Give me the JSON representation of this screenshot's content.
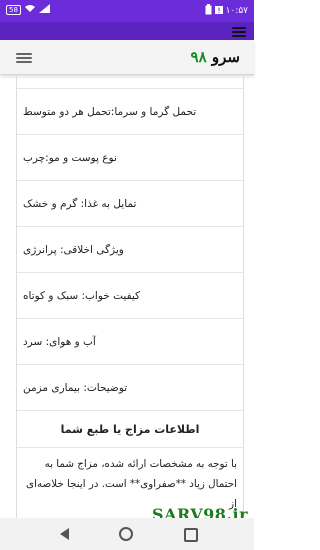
{
  "status_bar": {
    "time": "۱۰:۵۷",
    "badge": "58"
  },
  "header": {
    "logo_text": "سرو",
    "logo_number": "۹۸"
  },
  "rows": [
    {
      "text": ""
    },
    {
      "text": "تحمل گرما و سرما:تحمل هر دو متوسط"
    },
    {
      "text": "نوع پوست و مو:چرب"
    },
    {
      "text": "تمایل به غذا: گرم و خشک"
    },
    {
      "text": "ویژگی اخلاقی: پرانرژی"
    },
    {
      "text": "کیفیت خواب: سبک و کوتاه"
    },
    {
      "text": "آب و هوای: سرد"
    },
    {
      "text": "توضیحات: بیماری مزمن"
    }
  ],
  "section": {
    "title": "اطلاعات مزاج یا طبع شما",
    "paragraph": "با توجه به مشخصات ارائه شده، مزاج شما به احتمال زیاد **صفراوی** است. در اینجا خلاصه‌ای از"
  },
  "watermark": "SARV98.ir",
  "colors": {
    "status_bar": "#6c2cd9",
    "toolbar": "#5a22bf",
    "logo_number": "#1a8a2a"
  }
}
